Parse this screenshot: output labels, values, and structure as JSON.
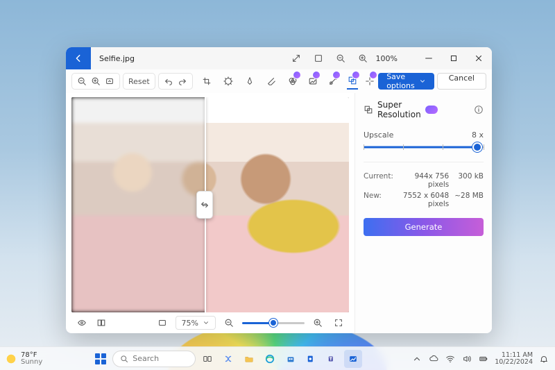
{
  "window": {
    "filename": "Selfie.jpg",
    "zoom_pct": "100%"
  },
  "toolbar": {
    "reset": "Reset",
    "save_options": "Save options",
    "cancel": "Cancel"
  },
  "canvas": {
    "view_pct": "75%"
  },
  "panel": {
    "title": "Super Resolution",
    "upscale_label": "Upscale",
    "upscale_value": "8 x",
    "current_label": "Current:",
    "current_dims": "944x 756 pixels",
    "current_size": "300 kB",
    "new_label": "New:",
    "new_dims": "7552 x 6048 pixels",
    "new_size": "~28 MB",
    "generate": "Generate"
  },
  "taskbar": {
    "temp": "78°F",
    "condition": "Sunny",
    "search_placeholder": "Search",
    "time": "11:11 AM",
    "date": "10/22/2024"
  }
}
